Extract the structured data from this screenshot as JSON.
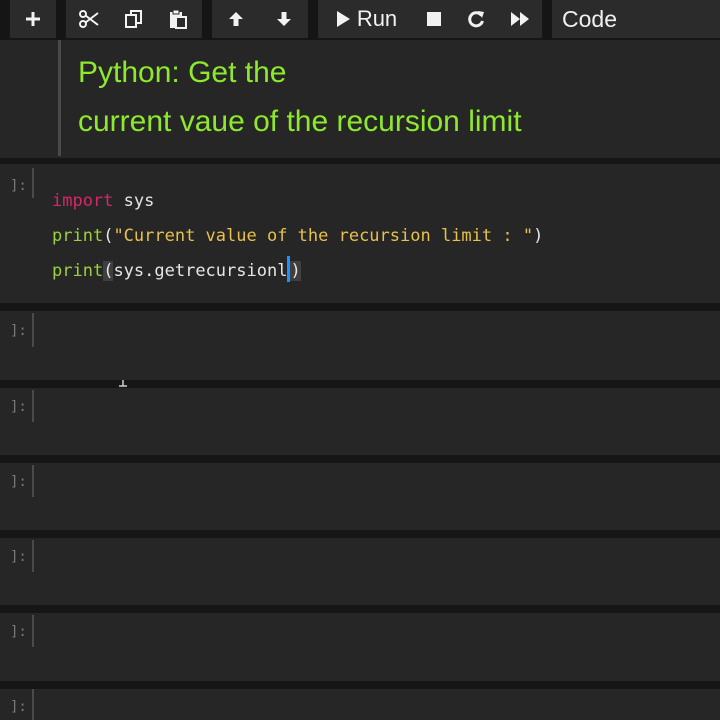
{
  "toolbar": {
    "buttons": [
      {
        "icon": "plus-icon",
        "glyph": "+"
      },
      {
        "icon": "scissors-icon",
        "glyph": "✂"
      },
      {
        "icon": "copy-icon"
      },
      {
        "icon": "paste-icon"
      },
      {
        "icon": "arrow-up-icon",
        "glyph": "🡑"
      },
      {
        "icon": "arrow-down-icon",
        "glyph": "🡓"
      }
    ],
    "run_label": "Run",
    "cell_type": "Code"
  },
  "markdown_cell": {
    "line1": "Python: Get the",
    "line2": "current vaue of the recursion limit"
  },
  "code_cells": [
    {
      "prompt": "]:",
      "code": [
        [
          {
            "t": "import",
            "k": "kw"
          },
          {
            "t": " sys",
            "k": "pn"
          }
        ],
        [
          {
            "t": "print",
            "k": "bi"
          },
          {
            "t": "(",
            "k": "pn"
          },
          {
            "t": "\"Current value of the recursion limit : \"",
            "k": "st"
          },
          {
            "t": ")",
            "k": "pn"
          }
        ],
        [
          {
            "t": "print",
            "k": "bi"
          },
          {
            "t": "(",
            "k": "pa"
          },
          {
            "t": "sys.getrecursionl",
            "k": "pn"
          },
          {
            "t": "CARET",
            "k": "caret"
          },
          {
            "t": ")",
            "k": "pa"
          }
        ]
      ]
    },
    {
      "prompt": "]:"
    },
    {
      "prompt": "]:"
    },
    {
      "prompt": "]:"
    },
    {
      "prompt": "]:"
    },
    {
      "prompt": "]:"
    },
    {
      "prompt": "]:"
    }
  ],
  "colors": {
    "heading": "#8ee82c",
    "keyword": "#d6266b",
    "builtin": "#9bd13c",
    "string": "#e8c04a",
    "caret": "#1e90ff",
    "background": "#262626"
  }
}
